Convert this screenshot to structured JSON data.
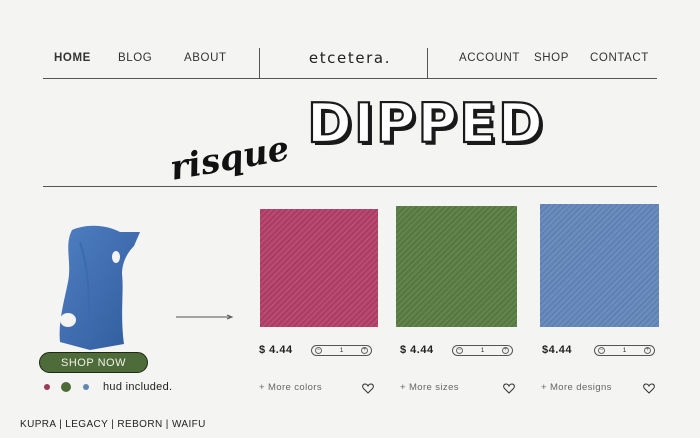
{
  "nav": {
    "left_items": [
      "HOME",
      "BLOG",
      "ABOUT"
    ],
    "brand": "etcetera.",
    "right_items": [
      "ACCOUNT",
      "SHOP",
      "CONTACT"
    ]
  },
  "hero": {
    "script_word": "risque",
    "headline": "DIPPED"
  },
  "featured": {
    "shop_now_label": "SHOP NOW",
    "hud_label": "hud included.",
    "color_dots": [
      "#9c3a5a",
      "#4c6b35",
      "#5f86b8"
    ]
  },
  "products": [
    {
      "swatch_color": "#b5406a",
      "price": "$ 4.44",
      "quantity": "1",
      "more_label": "+ More colors"
    },
    {
      "swatch_color": "#5c7e45",
      "price": "$ 4.44",
      "quantity": "1",
      "more_label": "+ More sizes"
    },
    {
      "swatch_color": "#6488bc",
      "price": "$4.44",
      "quantity": "1",
      "more_label": "+ More designs"
    }
  ],
  "footer": {
    "compat": "KUPRA | LEGACY | REBORN | WAIFU"
  },
  "colors": {
    "shop_button_bg": "#4e6b3a",
    "shop_button_border": "#1f2a16",
    "background": "#f4f4f3"
  }
}
